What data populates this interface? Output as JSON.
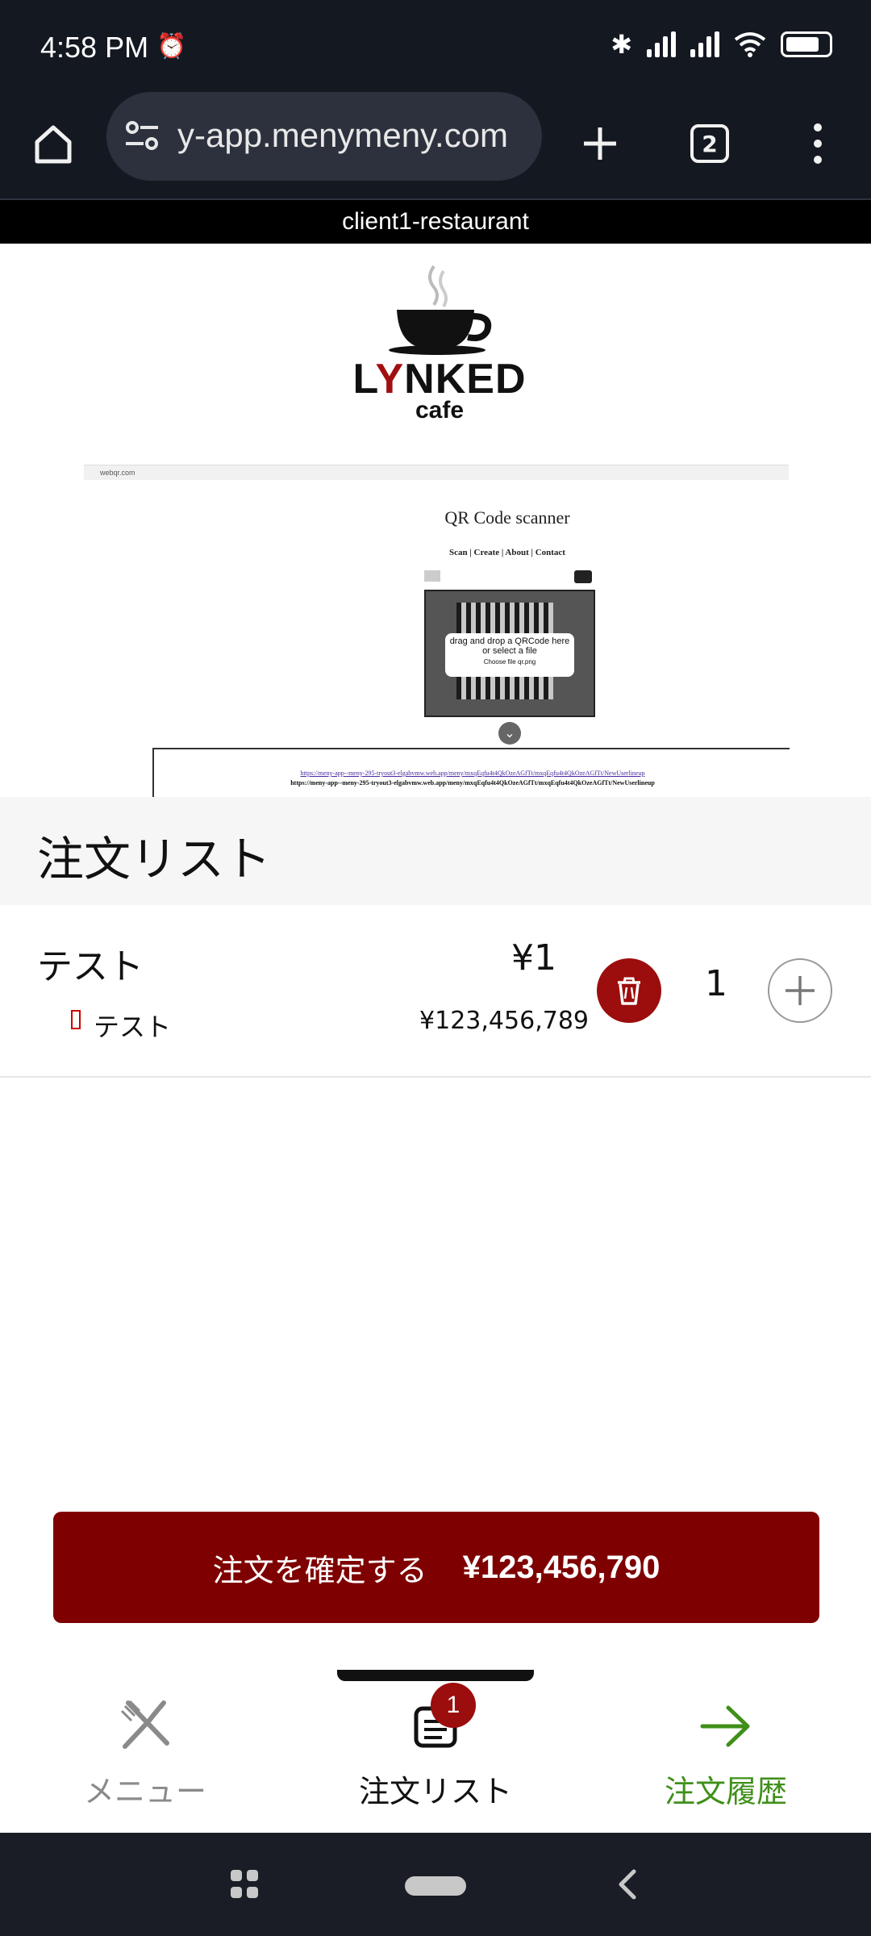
{
  "status_bar": {
    "time": "4:58 PM",
    "alarm_icon": "alarm-icon",
    "bluetooth_icon": "bluetooth-icon",
    "signal_icons": [
      "signal-icon",
      "signal-icon"
    ],
    "wifi_icon": "wifi-icon",
    "battery_icon": "battery-icon"
  },
  "browser": {
    "url": "y-app.menymeny.com",
    "tab_count": "2"
  },
  "restaurant": {
    "name": "client1-restaurant",
    "logo_brand": "LYNKED",
    "logo_brand_rest": "NKED",
    "logo_brand_start": "L",
    "logo_brand_y": "Y",
    "logo_sub": "cafe"
  },
  "banner": {
    "address": "webqr.com",
    "title": "QR Code scanner",
    "nav": "Scan | Create | About | Contact",
    "drop_text": "drag and drop a QRCode here or select a file",
    "file_button": "Choose file",
    "file_name": "qr.png",
    "link_text": "https://meny-app--meny-295-tryout3-elgabvmw.web.app/meny/mxqEqfu4t4QkOzeAGfTt/mxqEqfu4t4QkOzeAGfTt/NewUserlineup",
    "result_text": "https://meny-app--meny-295-tryout3-elgabvmw.web.app/meny/mxqEqfu4t4QkOzeAGfTt/mxqEqfu4t4QkOzeAGfTt/NewUserlineup"
  },
  "order_list": {
    "title": "注文リスト",
    "items": [
      {
        "name": "テスト",
        "price": "¥1",
        "option_name": "テスト",
        "option_price": "¥123,456,789",
        "quantity": "1"
      }
    ]
  },
  "confirm": {
    "label": "注文を確定する",
    "total": "¥123,456,790"
  },
  "bottom_nav": {
    "menu": "メニュー",
    "order_list": "注文リスト",
    "order_list_badge": "1",
    "history": "注文履歴"
  },
  "colors": {
    "accent": "#7f0000",
    "history_green": "#3f8f1a",
    "menu_gray": "#8a8a8a"
  }
}
